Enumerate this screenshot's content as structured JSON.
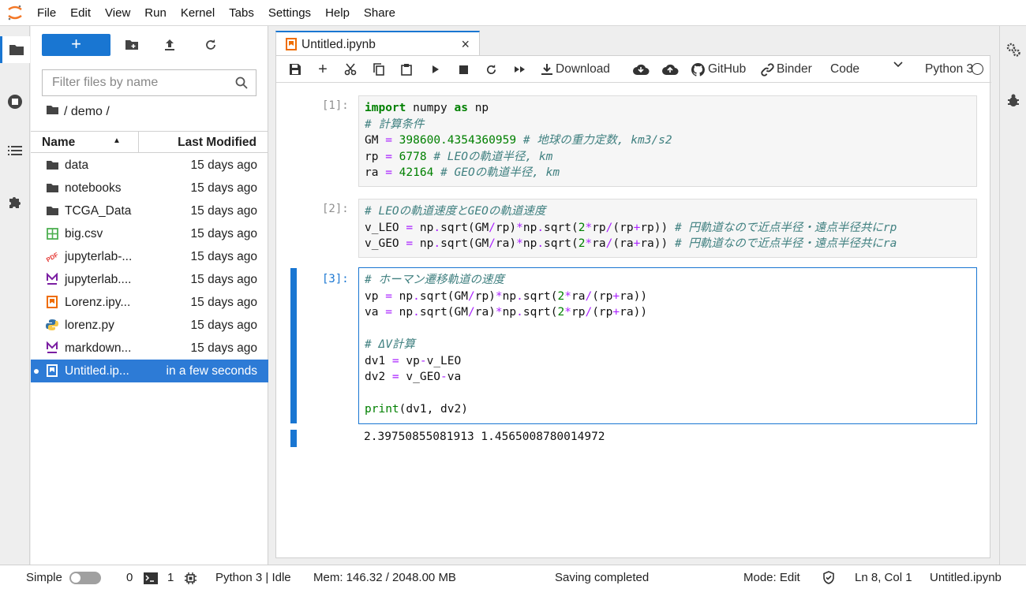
{
  "menu": {
    "items": [
      "File",
      "Edit",
      "View",
      "Run",
      "Kernel",
      "Tabs",
      "Settings",
      "Help",
      "Share"
    ]
  },
  "filebrowser": {
    "new_button_label": "+",
    "filter_placeholder": "Filter files by name",
    "breadcrumb": "/ demo /",
    "col_name": "Name",
    "col_modified": "Last Modified",
    "files": [
      {
        "name": "data",
        "modified": "15 days ago",
        "icon": "folder-icon"
      },
      {
        "name": "notebooks",
        "modified": "15 days ago",
        "icon": "folder-icon"
      },
      {
        "name": "TCGA_Data",
        "modified": "15 days ago",
        "icon": "folder-icon"
      },
      {
        "name": "big.csv",
        "modified": "15 days ago",
        "icon": "spreadsheet-icon"
      },
      {
        "name": "jupyterlab-...",
        "modified": "15 days ago",
        "icon": "pdf-icon"
      },
      {
        "name": "jupyterlab....",
        "modified": "15 days ago",
        "icon": "markdown-icon"
      },
      {
        "name": "Lorenz.ipy...",
        "modified": "15 days ago",
        "icon": "notebook-icon"
      },
      {
        "name": "lorenz.py",
        "modified": "15 days ago",
        "icon": "python-icon"
      },
      {
        "name": "markdown...",
        "modified": "15 days ago",
        "icon": "markdown-icon"
      },
      {
        "name": "Untitled.ip...",
        "modified": "in a few seconds",
        "icon": "notebook-icon",
        "selected": true
      }
    ]
  },
  "tab": {
    "title": "Untitled.ipynb",
    "close": "×"
  },
  "toolbar": {
    "download": "Download",
    "github": "GitHub",
    "binder": "Binder",
    "cell_type": "Code",
    "kernel": "Python 3"
  },
  "cells": {
    "c1": {
      "prompt": "[1]:"
    },
    "c2": {
      "prompt": "[2]:"
    },
    "c3": {
      "prompt": "[3]:",
      "output": "2.39750855081913 1.4565008780014972"
    }
  },
  "status": {
    "mode_label": "Simple",
    "terminals_count": "0",
    "kernels_count": "1",
    "kernel_status": "Python 3 | Idle",
    "memory": "Mem: 146.32 / 2048.00 MB",
    "saving": "Saving completed",
    "edit_mode": "Mode: Edit",
    "cursor": "Ln 8, Col 1",
    "filename": "Untitled.ipynb"
  },
  "colors": {
    "accent": "#1976d2",
    "selected_row": "#2d7bd6"
  }
}
